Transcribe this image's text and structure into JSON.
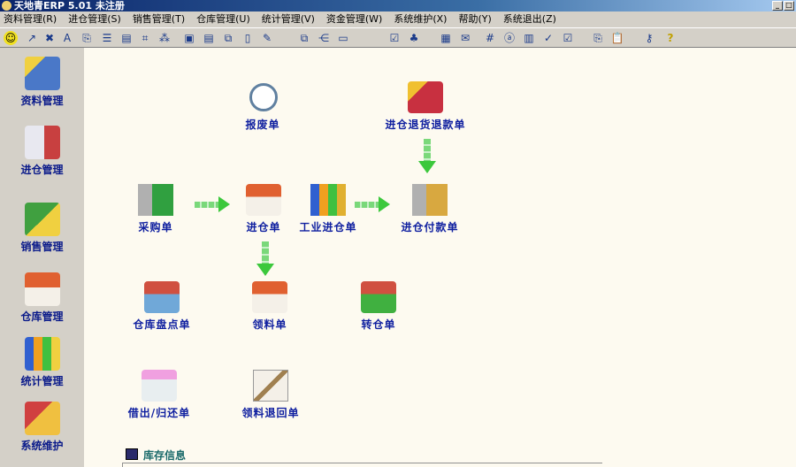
{
  "window": {
    "title": "天地青ERP 5.01 未注册",
    "minimize": "_",
    "maximize": "□"
  },
  "menu": [
    "资料管理(R)",
    "进仓管理(S)",
    "销售管理(T)",
    "仓库管理(U)",
    "统计管理(V)",
    "资金管理(W)",
    "系统维护(X)",
    "帮助(Y)",
    "系统退出(Z)"
  ],
  "toolbar": [
    {
      "icon": "smiley-icon",
      "glyph": "☺"
    },
    {
      "icon": "sort-icon",
      "glyph": "↗"
    },
    {
      "icon": "delete-record-icon",
      "glyph": "✖"
    },
    {
      "icon": "font-icon",
      "glyph": "A"
    },
    {
      "icon": "export-icon",
      "glyph": "⎘"
    },
    {
      "icon": "list-icon",
      "glyph": "☰"
    },
    {
      "icon": "align-icon",
      "glyph": "▤"
    },
    {
      "icon": "frame-icon",
      "glyph": "⌗"
    },
    {
      "icon": "scatter-icon",
      "glyph": "⁂"
    },
    {
      "icon": "camera-icon",
      "glyph": "▣"
    },
    {
      "icon": "align2-icon",
      "glyph": "▤"
    },
    {
      "icon": "group-icon",
      "glyph": "⧉"
    },
    {
      "icon": "document-icon",
      "glyph": "▯"
    },
    {
      "icon": "pen-icon",
      "glyph": "✎"
    },
    {
      "icon": "network-icon",
      "glyph": "⧉"
    },
    {
      "icon": "tree-icon",
      "glyph": "⋲"
    },
    {
      "icon": "window-icon",
      "glyph": "▭"
    },
    {
      "icon": "checklist-icon",
      "glyph": "☑"
    },
    {
      "icon": "hierarchy-icon",
      "glyph": "♣"
    },
    {
      "icon": "calendar-icon",
      "glyph": "▦"
    },
    {
      "icon": "message-icon",
      "glyph": "✉"
    },
    {
      "icon": "hash-icon",
      "glyph": "#"
    },
    {
      "icon": "variable-icon",
      "glyph": "ⓐ"
    },
    {
      "icon": "chart-icon",
      "glyph": "▥"
    },
    {
      "icon": "check-doc-icon",
      "glyph": "✓"
    },
    {
      "icon": "edit-check-icon",
      "glyph": "☑"
    },
    {
      "icon": "copy-icon",
      "glyph": "⎘"
    },
    {
      "icon": "paste-icon",
      "glyph": "📋"
    },
    {
      "icon": "key-icon",
      "glyph": "⚷"
    },
    {
      "icon": "help-icon",
      "glyph": "?"
    }
  ],
  "sidebar": [
    "资料管理",
    "进仓管理",
    "销售管理",
    "仓库管理",
    "统计管理",
    "系统维护"
  ],
  "flow": {
    "scrap": "报废单",
    "purchase_return_refund": "进仓退货退款单",
    "purchase_order": "采购单",
    "stock_in": "进仓单",
    "industrial_stock_in": "工业进仓单",
    "stock_in_payment": "进仓付款单",
    "inventory_check": "仓库盘点单",
    "material_requisition": "领料单",
    "warehouse_transfer": "转仓单",
    "lend_return": "借出/归还单",
    "material_return": "领料退回单"
  },
  "stock_info": "库存信息",
  "colors": {
    "accent": "#1020a0",
    "background": "#fdfaf0",
    "panel": "#d4d0c8"
  }
}
